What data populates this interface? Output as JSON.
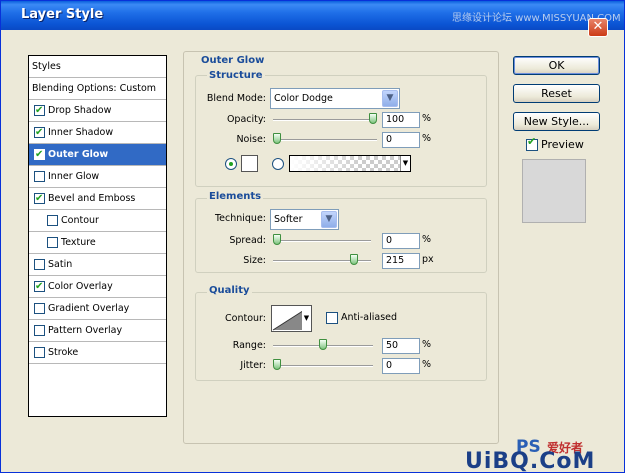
{
  "window": {
    "title": "Layer Style",
    "watermark": "思缘设计论坛 www.MISSYUAN.COM",
    "close_glyph": "✕"
  },
  "styles_panel": {
    "items": [
      {
        "label": "Styles",
        "checkbox": false,
        "checked": false,
        "selected": false,
        "indent": 0,
        "header": true
      },
      {
        "label": "Blending Options: Custom",
        "checkbox": false,
        "checked": false,
        "selected": false,
        "indent": 0,
        "header": true
      },
      {
        "label": "Drop Shadow",
        "checkbox": true,
        "checked": true,
        "selected": false,
        "indent": 0
      },
      {
        "label": "Inner Shadow",
        "checkbox": true,
        "checked": true,
        "selected": false,
        "indent": 0
      },
      {
        "label": "Outer Glow",
        "checkbox": true,
        "checked": true,
        "selected": true,
        "indent": 0
      },
      {
        "label": "Inner Glow",
        "checkbox": true,
        "checked": false,
        "selected": false,
        "indent": 0
      },
      {
        "label": "Bevel and Emboss",
        "checkbox": true,
        "checked": true,
        "selected": false,
        "indent": 0
      },
      {
        "label": "Contour",
        "checkbox": true,
        "checked": false,
        "selected": false,
        "indent": 1
      },
      {
        "label": "Texture",
        "checkbox": true,
        "checked": false,
        "selected": false,
        "indent": 1
      },
      {
        "label": "Satin",
        "checkbox": true,
        "checked": false,
        "selected": false,
        "indent": 0
      },
      {
        "label": "Color Overlay",
        "checkbox": true,
        "checked": true,
        "selected": false,
        "indent": 0
      },
      {
        "label": "Gradient Overlay",
        "checkbox": true,
        "checked": false,
        "selected": false,
        "indent": 0
      },
      {
        "label": "Pattern Overlay",
        "checkbox": true,
        "checked": false,
        "selected": false,
        "indent": 0
      },
      {
        "label": "Stroke",
        "checkbox": true,
        "checked": false,
        "selected": false,
        "indent": 0
      }
    ]
  },
  "outer_glow": {
    "title": "Outer Glow",
    "structure": {
      "title": "Structure",
      "blend_mode_label": "Blend Mode:",
      "blend_mode_value": "Color Dodge",
      "opacity_label": "Opacity:",
      "opacity_value": "100",
      "opacity_level": 1.0,
      "noise_label": "Noise:",
      "noise_value": "0",
      "noise_level": 0.0,
      "percent": "%",
      "color_mode": "solid",
      "color_swatch": "#ffffff"
    },
    "elements": {
      "title": "Elements",
      "technique_label": "Technique:",
      "technique_value": "Softer",
      "spread_label": "Spread:",
      "spread_value": "0",
      "spread_level": 0.0,
      "size_label": "Size:",
      "size_value": "215",
      "size_level": 0.86,
      "percent": "%",
      "px": "px"
    },
    "quality": {
      "title": "Quality",
      "contour_label": "Contour:",
      "anti_aliased_label": "Anti-aliased",
      "anti_aliased_checked": false,
      "range_label": "Range:",
      "range_value": "50",
      "range_level": 0.5,
      "jitter_label": "Jitter:",
      "jitter_value": "0",
      "jitter_level": 0.0,
      "percent": "%"
    }
  },
  "buttons": {
    "ok": "OK",
    "reset": "Reset",
    "new_style": "New Style...",
    "preview_label": "Preview",
    "preview_checked": true
  },
  "branding": {
    "ps": "PS",
    "cn": "爱好者",
    "url": "UiBQ.CoM"
  },
  "colors": {
    "title_bar": "#0a5fdc",
    "selection": "#316ac5",
    "heading": "#1a4c9a",
    "check": "#21a121"
  }
}
